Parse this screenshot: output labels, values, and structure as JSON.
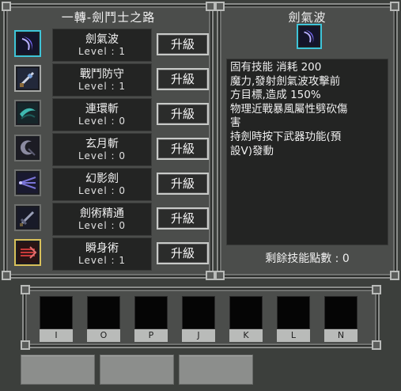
{
  "skill_panel": {
    "title": "一轉-劍鬥士之路",
    "upgrade_label": "升級",
    "skills": [
      {
        "name": "劍氣波",
        "level": "Level : 1",
        "icon": "crescent-slash-icon"
      },
      {
        "name": "戰鬥防守",
        "level": "Level : 1",
        "icon": "sword-guard-icon"
      },
      {
        "name": "連環斬",
        "level": "Level : 0",
        "icon": "chain-slash-icon"
      },
      {
        "name": "玄月斬",
        "level": "Level : 0",
        "icon": "moon-slash-icon"
      },
      {
        "name": "幻影劍",
        "level": "Level : 0",
        "icon": "phantom-sword-icon"
      },
      {
        "name": "劍術精通",
        "level": "Level : 0",
        "icon": "sword-mastery-icon"
      },
      {
        "name": "瞬身術",
        "level": "Level : 1",
        "icon": "dash-icon"
      }
    ]
  },
  "detail_panel": {
    "title": "劍氣波",
    "description": "固有技能 消耗 200\n魔力,發射劍氣波攻擊前\n方目標,造成 150%\n物理近戰暴風屬性劈砍傷\n害\n持劍時按下武器功能(預\n設V)發動",
    "remaining_points": "剩餘技能點數 : 0"
  },
  "hotbar": {
    "keys": [
      "I",
      "O",
      "P",
      "J",
      "K",
      "L",
      "N"
    ]
  },
  "colors": {
    "selected_border": "#3ec4d8",
    "panel_bg": "#4b4d4b",
    "text_box_bg": "#232423"
  }
}
